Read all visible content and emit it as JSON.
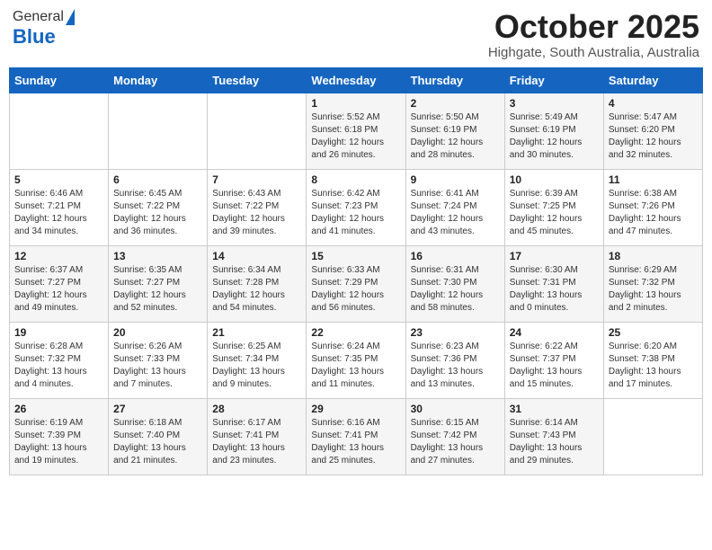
{
  "logo": {
    "general": "General",
    "blue": "Blue"
  },
  "title": {
    "month": "October 2025",
    "location": "Highgate, South Australia, Australia"
  },
  "weekdays": [
    "Sunday",
    "Monday",
    "Tuesday",
    "Wednesday",
    "Thursday",
    "Friday",
    "Saturday"
  ],
  "weeks": [
    [
      {
        "day": "",
        "info": ""
      },
      {
        "day": "",
        "info": ""
      },
      {
        "day": "",
        "info": ""
      },
      {
        "day": "1",
        "info": "Sunrise: 5:52 AM\nSunset: 6:18 PM\nDaylight: 12 hours\nand 26 minutes."
      },
      {
        "day": "2",
        "info": "Sunrise: 5:50 AM\nSunset: 6:19 PM\nDaylight: 12 hours\nand 28 minutes."
      },
      {
        "day": "3",
        "info": "Sunrise: 5:49 AM\nSunset: 6:19 PM\nDaylight: 12 hours\nand 30 minutes."
      },
      {
        "day": "4",
        "info": "Sunrise: 5:47 AM\nSunset: 6:20 PM\nDaylight: 12 hours\nand 32 minutes."
      }
    ],
    [
      {
        "day": "5",
        "info": "Sunrise: 6:46 AM\nSunset: 7:21 PM\nDaylight: 12 hours\nand 34 minutes."
      },
      {
        "day": "6",
        "info": "Sunrise: 6:45 AM\nSunset: 7:22 PM\nDaylight: 12 hours\nand 36 minutes."
      },
      {
        "day": "7",
        "info": "Sunrise: 6:43 AM\nSunset: 7:22 PM\nDaylight: 12 hours\nand 39 minutes."
      },
      {
        "day": "8",
        "info": "Sunrise: 6:42 AM\nSunset: 7:23 PM\nDaylight: 12 hours\nand 41 minutes."
      },
      {
        "day": "9",
        "info": "Sunrise: 6:41 AM\nSunset: 7:24 PM\nDaylight: 12 hours\nand 43 minutes."
      },
      {
        "day": "10",
        "info": "Sunrise: 6:39 AM\nSunset: 7:25 PM\nDaylight: 12 hours\nand 45 minutes."
      },
      {
        "day": "11",
        "info": "Sunrise: 6:38 AM\nSunset: 7:26 PM\nDaylight: 12 hours\nand 47 minutes."
      }
    ],
    [
      {
        "day": "12",
        "info": "Sunrise: 6:37 AM\nSunset: 7:27 PM\nDaylight: 12 hours\nand 49 minutes."
      },
      {
        "day": "13",
        "info": "Sunrise: 6:35 AM\nSunset: 7:27 PM\nDaylight: 12 hours\nand 52 minutes."
      },
      {
        "day": "14",
        "info": "Sunrise: 6:34 AM\nSunset: 7:28 PM\nDaylight: 12 hours\nand 54 minutes."
      },
      {
        "day": "15",
        "info": "Sunrise: 6:33 AM\nSunset: 7:29 PM\nDaylight: 12 hours\nand 56 minutes."
      },
      {
        "day": "16",
        "info": "Sunrise: 6:31 AM\nSunset: 7:30 PM\nDaylight: 12 hours\nand 58 minutes."
      },
      {
        "day": "17",
        "info": "Sunrise: 6:30 AM\nSunset: 7:31 PM\nDaylight: 13 hours\nand 0 minutes."
      },
      {
        "day": "18",
        "info": "Sunrise: 6:29 AM\nSunset: 7:32 PM\nDaylight: 13 hours\nand 2 minutes."
      }
    ],
    [
      {
        "day": "19",
        "info": "Sunrise: 6:28 AM\nSunset: 7:32 PM\nDaylight: 13 hours\nand 4 minutes."
      },
      {
        "day": "20",
        "info": "Sunrise: 6:26 AM\nSunset: 7:33 PM\nDaylight: 13 hours\nand 7 minutes."
      },
      {
        "day": "21",
        "info": "Sunrise: 6:25 AM\nSunset: 7:34 PM\nDaylight: 13 hours\nand 9 minutes."
      },
      {
        "day": "22",
        "info": "Sunrise: 6:24 AM\nSunset: 7:35 PM\nDaylight: 13 hours\nand 11 minutes."
      },
      {
        "day": "23",
        "info": "Sunrise: 6:23 AM\nSunset: 7:36 PM\nDaylight: 13 hours\nand 13 minutes."
      },
      {
        "day": "24",
        "info": "Sunrise: 6:22 AM\nSunset: 7:37 PM\nDaylight: 13 hours\nand 15 minutes."
      },
      {
        "day": "25",
        "info": "Sunrise: 6:20 AM\nSunset: 7:38 PM\nDaylight: 13 hours\nand 17 minutes."
      }
    ],
    [
      {
        "day": "26",
        "info": "Sunrise: 6:19 AM\nSunset: 7:39 PM\nDaylight: 13 hours\nand 19 minutes."
      },
      {
        "day": "27",
        "info": "Sunrise: 6:18 AM\nSunset: 7:40 PM\nDaylight: 13 hours\nand 21 minutes."
      },
      {
        "day": "28",
        "info": "Sunrise: 6:17 AM\nSunset: 7:41 PM\nDaylight: 13 hours\nand 23 minutes."
      },
      {
        "day": "29",
        "info": "Sunrise: 6:16 AM\nSunset: 7:41 PM\nDaylight: 13 hours\nand 25 minutes."
      },
      {
        "day": "30",
        "info": "Sunrise: 6:15 AM\nSunset: 7:42 PM\nDaylight: 13 hours\nand 27 minutes."
      },
      {
        "day": "31",
        "info": "Sunrise: 6:14 AM\nSunset: 7:43 PM\nDaylight: 13 hours\nand 29 minutes."
      },
      {
        "day": "",
        "info": ""
      }
    ]
  ]
}
